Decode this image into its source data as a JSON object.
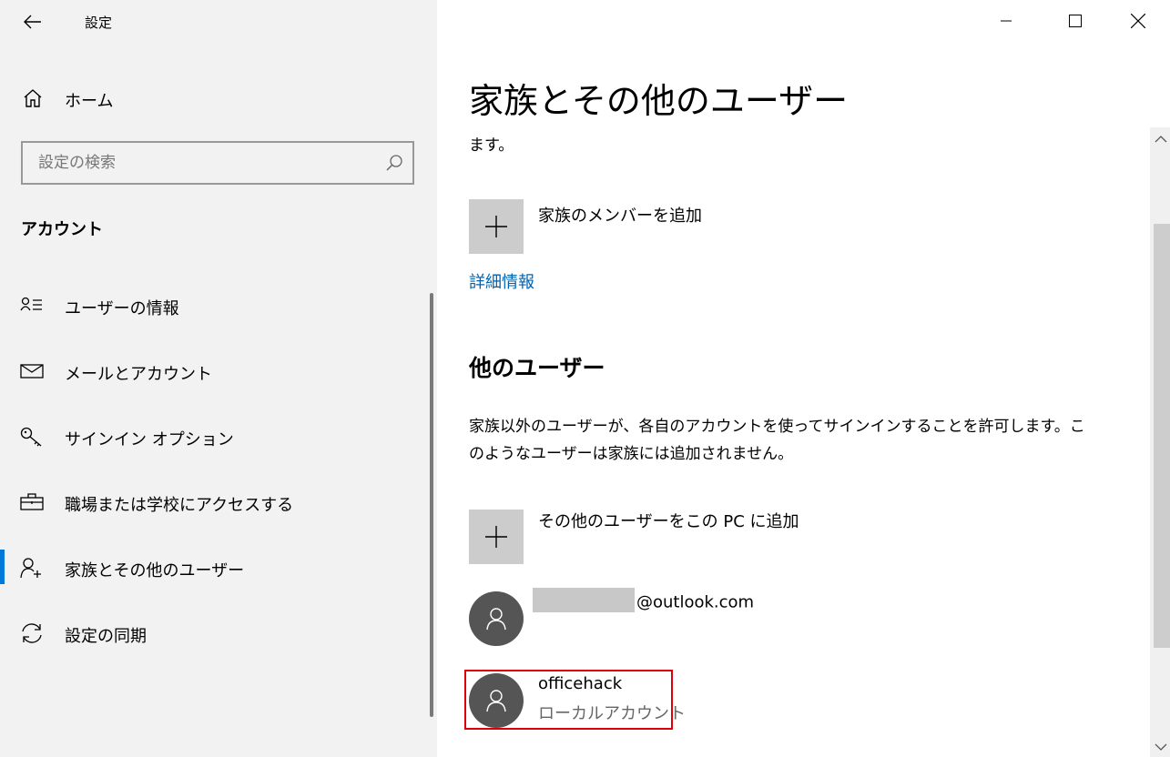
{
  "window": {
    "title": "設定"
  },
  "sidebar": {
    "home_label": "ホーム",
    "search_placeholder": "設定の検索",
    "section_title": "アカウント",
    "items": [
      {
        "label": "ユーザーの情報",
        "icon": "user-info-icon"
      },
      {
        "label": "メールとアカウント",
        "icon": "mail-icon"
      },
      {
        "label": "サインイン オプション",
        "icon": "key-icon"
      },
      {
        "label": "職場または学校にアクセスする",
        "icon": "briefcase-icon"
      },
      {
        "label": "家族とその他のユーザー",
        "icon": "add-person-icon",
        "active": true
      },
      {
        "label": "設定の同期",
        "icon": "sync-icon"
      }
    ]
  },
  "main": {
    "title": "家族とその他のユーザー",
    "cut_text": "ます。",
    "add_family_label": "家族のメンバーを追加",
    "more_info_link": "詳細情報",
    "other_users_heading": "他のユーザー",
    "other_users_desc_1": "家族以外のユーザーが、各自のアカウントを使ってサインインすることを許可します。こ",
    "other_users_desc_2": "のようなユーザーは家族には追加されません。",
    "add_other_label": "その他のユーザーをこの PC に追加",
    "users": [
      {
        "name_suffix": "@outlook.com",
        "redacted": true
      },
      {
        "name": "officehack",
        "type": "ローカルアカウント",
        "highlighted": true
      }
    ]
  },
  "colors": {
    "accent": "#0078d7",
    "link": "#0063b1",
    "highlight": "#e0000a",
    "avatar": "#555555"
  }
}
